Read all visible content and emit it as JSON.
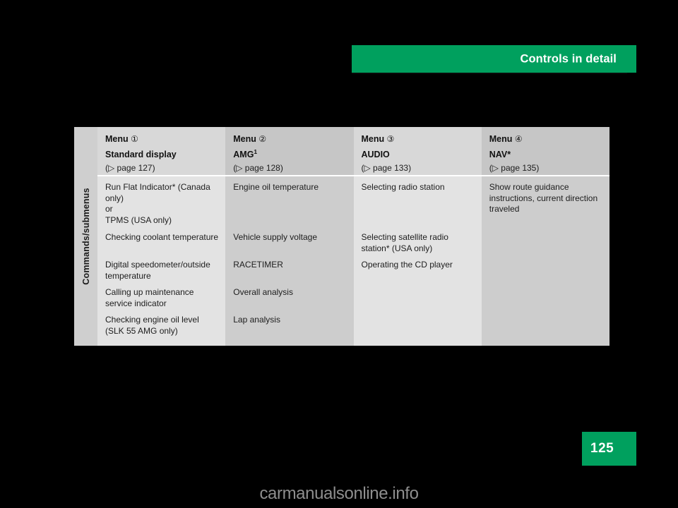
{
  "header": {
    "title": "Controls in detail",
    "banner_color": "#00a05e"
  },
  "side_label": "Commands/submenus",
  "table": {
    "columns": [
      {
        "header_menu": "Menu",
        "header_number": "①",
        "header_name": "Standard display",
        "header_name_sup": "",
        "page_ref": "(▷ page 127)",
        "cells": [
          "Run Flat Indicator* (Canada only)\nor\nTPMS (USA only)",
          "Checking coolant temperature",
          "Digital speedometer/outside temperature",
          "Calling up maintenance service indicator",
          "Checking engine oil level (SLK 55 AMG only)"
        ]
      },
      {
        "header_menu": "Menu",
        "header_number": "②",
        "header_name": "AMG",
        "header_name_sup": "1",
        "page_ref": "(▷ page 128)",
        "cells": [
          "Engine oil temperature",
          "Vehicle supply voltage",
          "RACETIMER",
          "Overall analysis",
          "Lap analysis"
        ]
      },
      {
        "header_menu": "Menu",
        "header_number": "③",
        "header_name": "AUDIO",
        "header_name_sup": "",
        "page_ref": "(▷ page 133)",
        "cells": [
          "Selecting radio station",
          "Selecting satellite radio station* (USA only)",
          "Operating the CD player",
          "",
          ""
        ]
      },
      {
        "header_menu": "Menu",
        "header_number": "④",
        "header_name": "NAV*",
        "header_name_sup": "",
        "page_ref": "(▷ page 135)",
        "cells": [
          "Show route guidance instructions, current direction traveled",
          "",
          "",
          "",
          ""
        ]
      }
    ]
  },
  "footer": {
    "page_number": "125",
    "watermark": "carmanualsonline.info"
  }
}
